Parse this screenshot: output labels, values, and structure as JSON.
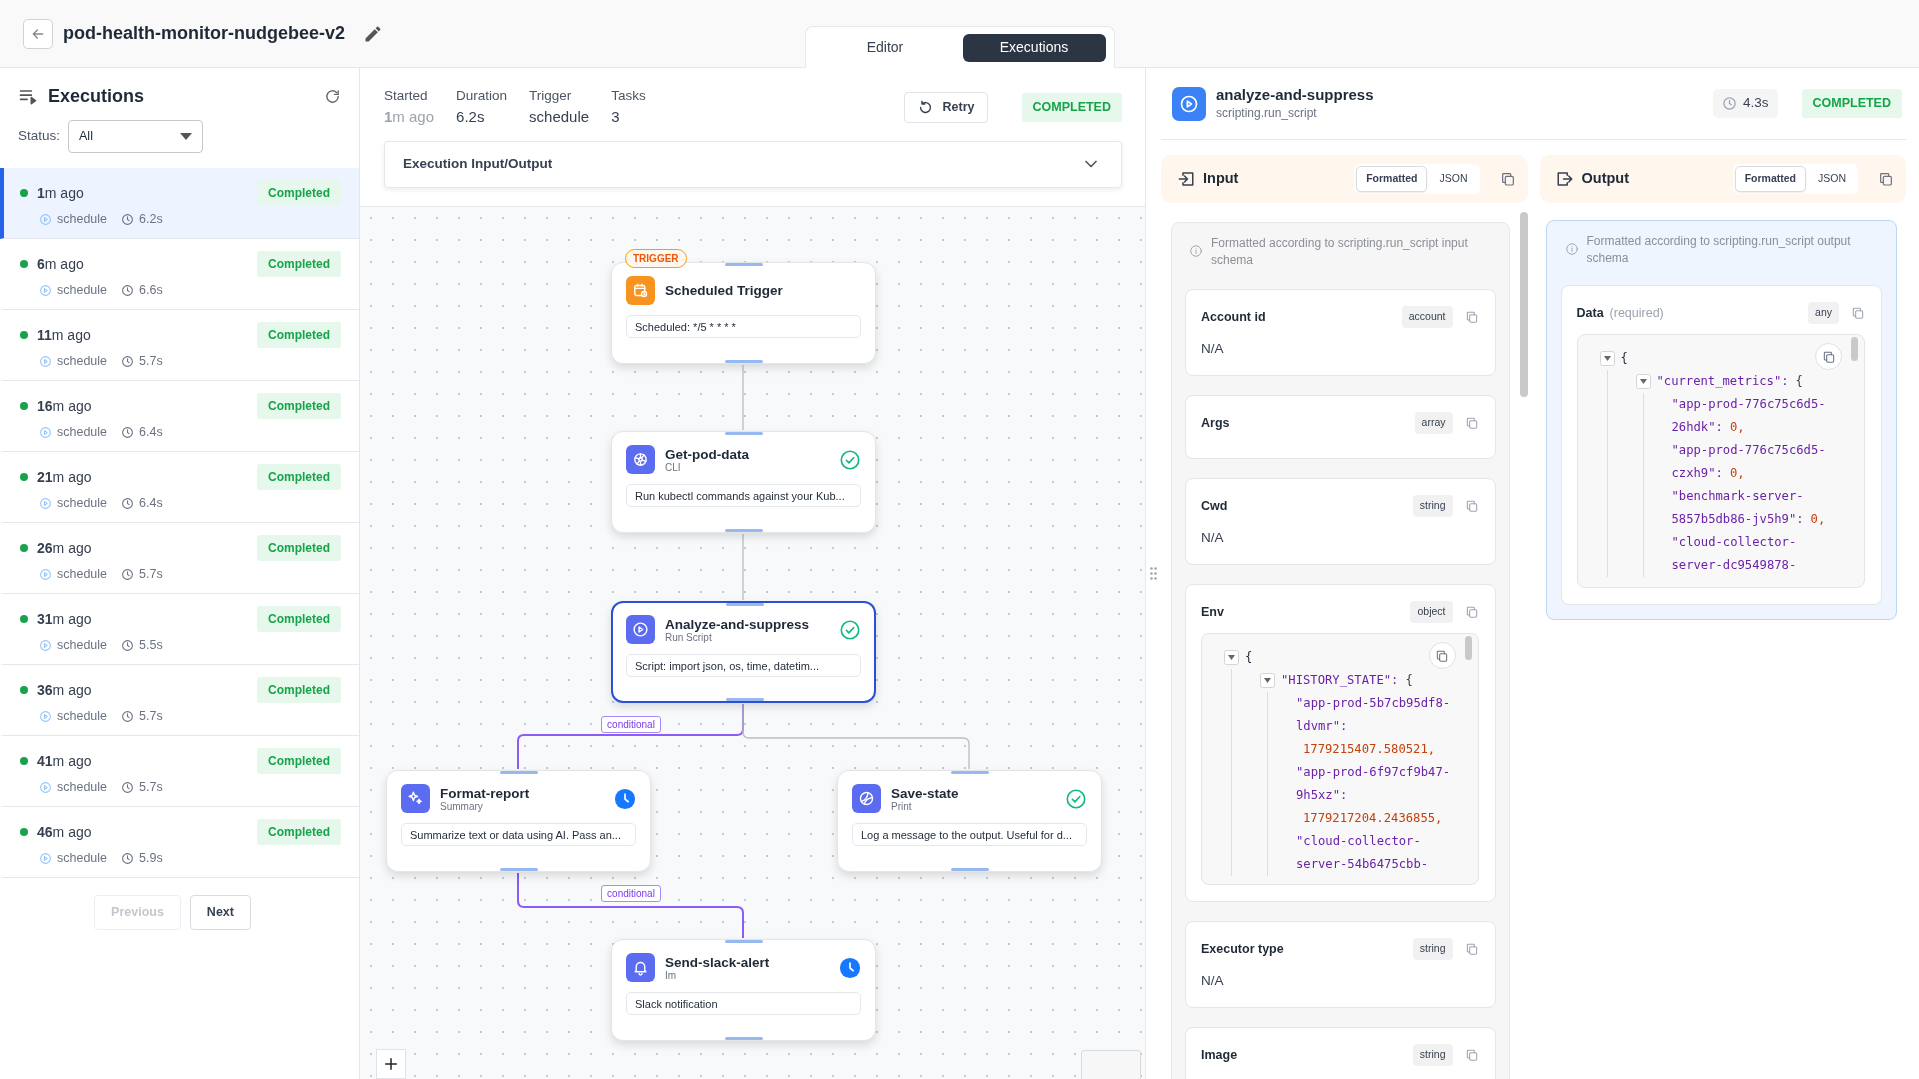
{
  "header": {
    "title": "pod-health-monitor-nudgebee-v2",
    "tabs": [
      {
        "label": "Editor",
        "selected": false
      },
      {
        "label": "Executions",
        "selected": true
      }
    ]
  },
  "executions_panel": {
    "title": "Executions",
    "status_filter": {
      "label": "Status:",
      "value": "All"
    },
    "items": [
      {
        "time": "**1**m ago",
        "status": "Completed",
        "trigger": "schedule",
        "duration": "6.2s",
        "selected": true
      },
      {
        "time": "**6**m ago",
        "status": "Completed",
        "trigger": "schedule",
        "duration": "6.6s",
        "selected": false
      },
      {
        "time": "**11**m ago",
        "status": "Completed",
        "trigger": "schedule",
        "duration": "5.7s",
        "selected": false
      },
      {
        "time": "**16**m ago",
        "status": "Completed",
        "trigger": "schedule",
        "duration": "6.4s",
        "selected": false
      },
      {
        "time": "**21**m ago",
        "status": "Completed",
        "trigger": "schedule",
        "duration": "6.4s",
        "selected": false
      },
      {
        "time": "**26**m ago",
        "status": "Completed",
        "trigger": "schedule",
        "duration": "5.7s",
        "selected": false
      },
      {
        "time": "**31**m ago",
        "status": "Completed",
        "trigger": "schedule",
        "duration": "5.5s",
        "selected": false
      },
      {
        "time": "**36**m ago",
        "status": "Completed",
        "trigger": "schedule",
        "duration": "5.7s",
        "selected": false
      },
      {
        "time": "**41**m ago",
        "status": "Completed",
        "trigger": "schedule",
        "duration": "5.7s",
        "selected": false
      },
      {
        "time": "**46**m ago",
        "status": "Completed",
        "trigger": "schedule",
        "duration": "5.9s",
        "selected": false
      }
    ],
    "pagination": [
      {
        "label": "Previous",
        "disabled": true
      },
      {
        "label": "Next",
        "disabled": false
      }
    ]
  },
  "summary": {
    "stats": [
      {
        "label": "Started",
        "value": "**1**m ago"
      },
      {
        "label": "Duration",
        "value": "6.2s"
      },
      {
        "label": "Trigger",
        "value": "schedule"
      },
      {
        "label": "Tasks",
        "value": "3"
      }
    ],
    "retry": "Retry",
    "status": "COMPLETED",
    "io_section": {
      "title": "Execution Input/Output",
      "expanded": false
    }
  },
  "workflow": {
    "nodes": [
      {
        "kind": "trigger",
        "badge": "TRIGGER",
        "title": "Scheduled Trigger",
        "description": "Scheduled: */5 * * * *",
        "selected": false
      },
      {
        "kind": "task",
        "title": "Get-pod-data",
        "subtitle": "CLI",
        "description": "Run kubectl commands against your Kub...",
        "completed": true,
        "selected": false
      },
      {
        "kind": "task",
        "title": "Analyze-and-suppress",
        "subtitle": "Run Script",
        "description": "Script: import json, os, time, datetim...",
        "completed": true,
        "selected": true
      },
      {
        "kind": "task",
        "title": "Format-report",
        "subtitle": "Summary",
        "description": "Summarize text or data using AI. Pass an...",
        "completed": false,
        "selected": false
      },
      {
        "kind": "task",
        "title": "Save-state",
        "subtitle": "Print",
        "description": "Log a message to the output. Useful for d...",
        "completed": true,
        "selected": false
      },
      {
        "kind": "task",
        "title": "Send-slack-alert",
        "subtitle": "Im",
        "description": "Slack notification",
        "completed": false,
        "selected": false
      }
    ],
    "edges": [
      {
        "kind": "plain"
      },
      {
        "kind": "plain"
      },
      {
        "kind": "conditional",
        "label": "conditional"
      },
      {
        "kind": "plain"
      },
      {
        "kind": "conditional",
        "label": "conditional"
      }
    ]
  },
  "task_panel": {
    "title": "analyze-and-suppress",
    "subtitle": "scripting.run_script",
    "duration": "4.3s",
    "status": "COMPLETED",
    "input": {
      "title": "Input",
      "view_tabs": [
        {
          "label": "Formatted",
          "selected": true
        },
        {
          "label": "JSON",
          "selected": false
        }
      ],
      "info": "Formatted according to scripting.run_script input schema",
      "fields": [
        {
          "name": "Account id",
          "type": "account",
          "kind": "text",
          "value": "N/A"
        },
        {
          "name": "Args",
          "type": "array",
          "kind": "text"
        },
        {
          "name": "Cwd",
          "type": "string",
          "kind": "text",
          "value": "N/A"
        },
        {
          "name": "Env",
          "type": "object",
          "kind": "tree",
          "tree": [
            {
              "text": "{",
              "expanded": true,
              "children": [
                {
                  "key": "\"HISTORY_STATE\":",
                  "text": "{",
                  "expanded": true,
                  "children": [
                    {
                      "key": "\"app-prod-5b7cb95df8-ldvmr\":",
                      "value": "1779215407.580521,"
                    },
                    {
                      "key": "\"app-prod-6f97cf9b47-9h5xz\":",
                      "value": "1779217204.2436855,"
                    },
                    {
                      "key": "\"cloud-collector-server-54b6475cbb-"
                    }
                  ]
                }
              ]
            }
          ]
        },
        {
          "name": "Executor type",
          "type": "string",
          "kind": "text",
          "value": "N/A"
        },
        {
          "name": "Image",
          "type": "string",
          "kind": "text"
        }
      ]
    },
    "output": {
      "title": "Output",
      "view_tabs": [
        {
          "label": "Formatted",
          "selected": true
        },
        {
          "label": "JSON",
          "selected": false
        }
      ],
      "info": "Formatted according to scripting.run_script output schema",
      "fields": [
        {
          "name": "Data",
          "note": "(required)",
          "type": "any",
          "kind": "tree",
          "tree": [
            {
              "text": "{",
              "expanded": true,
              "children": [
                {
                  "key": "\"current_metrics\":",
                  "text": "{",
                  "expanded": true,
                  "children": [
                    {
                      "key": "\"app-prod-776c75c6d5-26hdk\":",
                      "value": "0,"
                    },
                    {
                      "key": "\"app-prod-776c75c6d5-czxh9\":",
                      "value": "0,"
                    },
                    {
                      "key": "\"benchmark-server-5857b5db86-jv5h9\":",
                      "value": "0,"
                    },
                    {
                      "key": "\"cloud-collector-server-dc9549878-"
                    }
                  ]
                }
              ]
            }
          ]
        }
      ]
    }
  }
}
